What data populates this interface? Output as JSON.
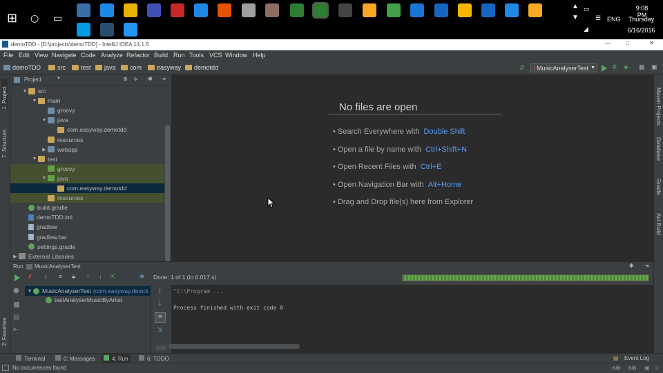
{
  "taskbar": {
    "time": "9:08 PM",
    "day": "Thursday",
    "date": "6/16/2016",
    "language": "ENG",
    "apps": [
      "settings",
      "chrome",
      "norton",
      "network",
      "filezilla",
      "dropbox",
      "vlc",
      "media",
      "security",
      "camtasia",
      "camtasia-recorder",
      "unity",
      "git",
      "android",
      "remote",
      "chat",
      "minecraft",
      "outlook",
      "remote-desktop",
      "media-player",
      "skype",
      "intellij",
      "device"
    ]
  },
  "window": {
    "title": "demoTDD - [D:\\projects\\demoTDD] - IntelliJ IDEA 14.1.5",
    "min": "—",
    "max": "□",
    "close": "✕"
  },
  "menu": [
    "File",
    "Edit",
    "View",
    "Navigate",
    "Code",
    "Analyze",
    "Refactor",
    "Build",
    "Run",
    "Tools",
    "VCS",
    "Window",
    "Help"
  ],
  "breadcrumbs": [
    "demoTDD",
    "src",
    "test",
    "java",
    "com",
    "easyway",
    "demotdd"
  ],
  "run_config": "MusicAnalyserTest",
  "left_strip": {
    "project": "1: Project",
    "structure": "7: Structure",
    "favorites": "2: Favorites"
  },
  "right_strip": {
    "maven": "Maven Projects",
    "database": "Database",
    "gradle": "Gradle",
    "ant": "Ant Build"
  },
  "project": {
    "header": "Project",
    "tree": [
      {
        "label": "src",
        "indent": 1,
        "arrow": "▼",
        "icon": "folder",
        "style": ""
      },
      {
        "label": "main",
        "indent": 2,
        "arrow": "▼",
        "icon": "folder",
        "style": ""
      },
      {
        "label": "groovy",
        "indent": 3,
        "arrow": "",
        "icon": "folder-blue",
        "style": ""
      },
      {
        "label": "java",
        "indent": 3,
        "arrow": "▼",
        "icon": "folder-blue",
        "style": ""
      },
      {
        "label": "com.easyway.demotdd",
        "indent": 4,
        "arrow": "",
        "icon": "folder",
        "style": ""
      },
      {
        "label": "resources",
        "indent": 3,
        "arrow": "",
        "icon": "folder",
        "style": ""
      },
      {
        "label": "webapp",
        "indent": 3,
        "arrow": "▶",
        "icon": "folder-blue",
        "style": ""
      },
      {
        "label": "test",
        "indent": 2,
        "arrow": "▼",
        "icon": "folder",
        "style": ""
      },
      {
        "label": "groovy",
        "indent": 3,
        "arrow": "",
        "icon": "folder-green",
        "style": "hl-green"
      },
      {
        "label": "java",
        "indent": 3,
        "arrow": "▼",
        "icon": "folder-green",
        "style": "hl-green"
      },
      {
        "label": "com.easyway.demotdd",
        "indent": 4,
        "arrow": "",
        "icon": "folder",
        "style": "selected"
      },
      {
        "label": "resources",
        "indent": 3,
        "arrow": "",
        "icon": "folder",
        "style": "hl-green"
      },
      {
        "label": "build.gradle",
        "indent": 1,
        "arrow": "",
        "icon": "gradle",
        "style": ""
      },
      {
        "label": "demoTDD.iml",
        "indent": 1,
        "arrow": "",
        "icon": "iml",
        "style": ""
      },
      {
        "label": "gradlew",
        "indent": 1,
        "arrow": "",
        "icon": "file",
        "style": ""
      },
      {
        "label": "gradlew.bat",
        "indent": 1,
        "arrow": "",
        "icon": "file",
        "style": ""
      },
      {
        "label": "settings.gradle",
        "indent": 1,
        "arrow": "",
        "icon": "gradle",
        "style": ""
      },
      {
        "label": "External Libraries",
        "indent": 0,
        "arrow": "▶",
        "icon": "lib",
        "style": ""
      }
    ]
  },
  "editor": {
    "title": "No files are open",
    "tips": [
      {
        "text": "• Search Everywhere with",
        "shortcut": "Double Shift"
      },
      {
        "text": "• Open a file by name with",
        "shortcut": "Ctrl+Shift+N"
      },
      {
        "text": "• Open Recent Files with",
        "shortcut": "Ctrl+E"
      },
      {
        "text": "• Open Navigation Bar with",
        "shortcut": "Alt+Home"
      },
      {
        "text": "• Drag and Drop file(s) here from Explorer",
        "shortcut": ""
      }
    ]
  },
  "run": {
    "label": "Run",
    "tab": "MusicAnalyserTest",
    "status": "Done: 1 of 1 (in 0.017 s)",
    "progress": 1.0,
    "tree": [
      {
        "label": "MusicAnalyserTest",
        "suffix": "(com.easyway.demot",
        "indent": 0
      },
      {
        "label": "testAnalyserMusicByArtist",
        "suffix": "",
        "indent": 1
      }
    ],
    "console": [
      "\"C:\\Program ...",
      "",
      "Process finished with exit code 0"
    ]
  },
  "tool_tabs": [
    {
      "label": "Terminal",
      "underline": ""
    },
    {
      "label": "0: Messages",
      "underline": "0"
    },
    {
      "label": "4: Run",
      "underline": "4"
    },
    {
      "label": "6: TODO",
      "underline": "6"
    }
  ],
  "event_log": "Event Log",
  "status": {
    "message": "No occurrences found",
    "pos1": "n/a",
    "pos2": "n/a"
  },
  "colors": {
    "accent": "#589df6",
    "run_green": "#59a869",
    "selection": "#0d293e",
    "test_folder_bg": "#44502f"
  }
}
